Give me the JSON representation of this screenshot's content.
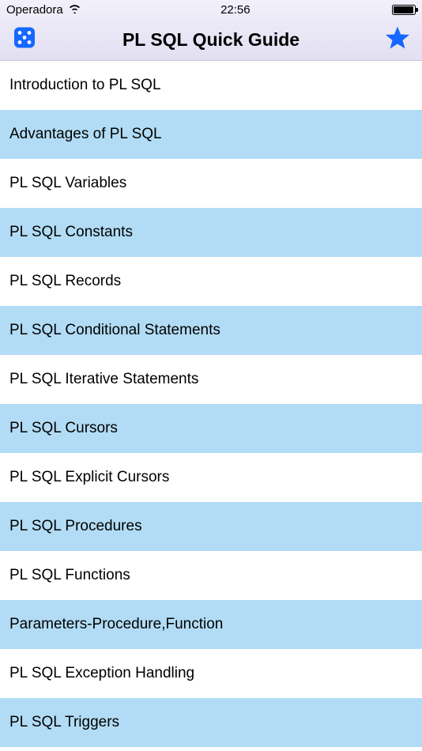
{
  "status_bar": {
    "carrier": "Operadora",
    "time": "22:56"
  },
  "nav": {
    "title": "PL SQL Quick Guide"
  },
  "list_items": [
    {
      "label": "Introduction to PL SQL",
      "alt": false
    },
    {
      "label": "Advantages of PL SQL",
      "alt": true
    },
    {
      "label": "PL SQL Variables",
      "alt": false
    },
    {
      "label": "PL SQL Constants",
      "alt": true
    },
    {
      "label": "PL SQL Records",
      "alt": false
    },
    {
      "label": "PL SQL Conditional Statements",
      "alt": true
    },
    {
      "label": "PL SQL Iterative Statements",
      "alt": false
    },
    {
      "label": "PL SQL Cursors",
      "alt": true
    },
    {
      "label": "PL SQL Explicit Cursors",
      "alt": false
    },
    {
      "label": "PL SQL Procedures",
      "alt": true
    },
    {
      "label": "PL SQL Functions",
      "alt": false
    },
    {
      "label": "Parameters-Procedure,Function",
      "alt": true
    },
    {
      "label": "PL SQL Exception Handling",
      "alt": false
    },
    {
      "label": "PL SQL Triggers",
      "alt": true
    }
  ]
}
